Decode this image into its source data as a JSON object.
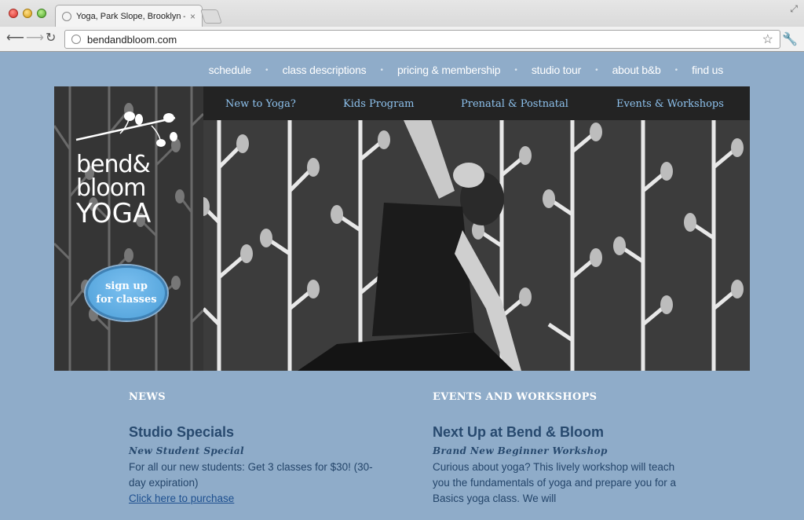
{
  "browser": {
    "tab_title": "Yoga, Park Slope, Brooklyn –",
    "tab_close": "×",
    "url": "bendandbloom.com",
    "icons": [
      "back-arrow-icon",
      "forward-arrow-icon",
      "reload-icon",
      "globe-icon",
      "star-icon",
      "wrench-icon",
      "close-icon"
    ]
  },
  "top_nav": {
    "items": [
      "schedule",
      "class descriptions",
      "pricing & membership",
      "studio tour",
      "about b&b",
      "find us"
    ]
  },
  "sub_nav": {
    "items": [
      "New to Yoga?",
      "Kids Program",
      "Prenatal & Postnatal",
      "Events & Workshops"
    ]
  },
  "logo": {
    "line1": "bend&",
    "line2": "bloom",
    "line3": "YOGA"
  },
  "signup": {
    "line1": "sign up",
    "line2": "for classes"
  },
  "news": {
    "heading": "NEWS",
    "title": "Studio Specials",
    "subtitle": "New Student Special",
    "body": "For all our new students: Get 3 classes for $30! (30-day expiration)",
    "link": "Click here to purchase"
  },
  "events": {
    "heading": "EVENTS AND WORKSHOPS",
    "title": "Next Up at Bend & Bloom",
    "subtitle": "Brand New Beginner Workshop",
    "body": "Curious about yoga? This lively workshop will teach you the fundamentals of yoga and prepare you for a Basics yoga class. We will"
  },
  "colors": {
    "page_bg": "#8facc9",
    "heading_blue": "#27496e",
    "subnav_blue": "#8ec2ee",
    "signup_blue": "#5aaee4"
  }
}
